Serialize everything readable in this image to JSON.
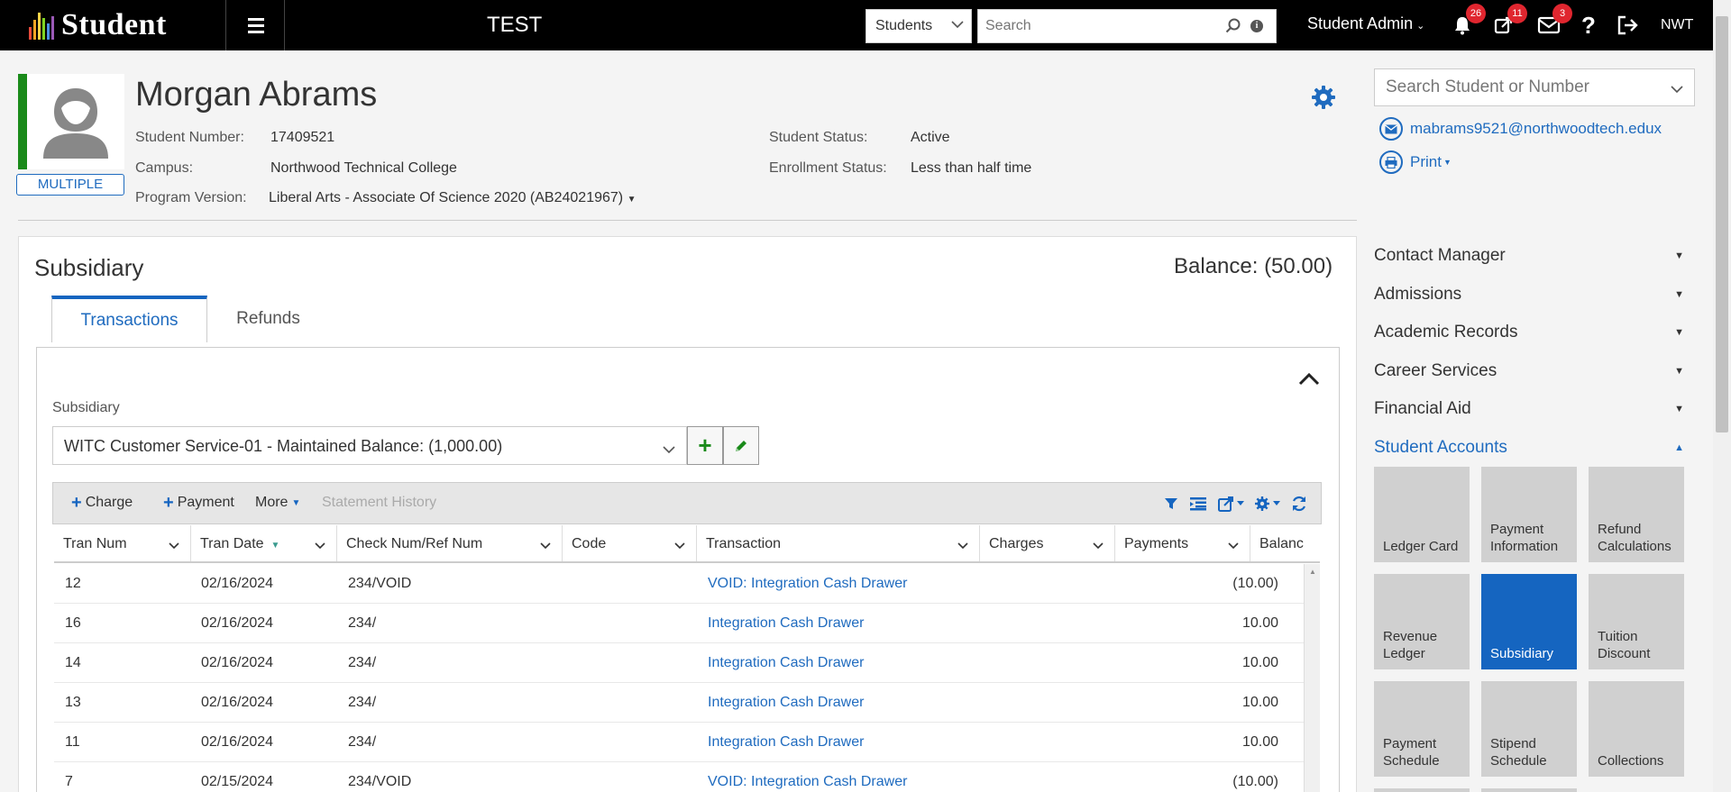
{
  "topbar": {
    "logo_text": "Student",
    "env_title": "TEST",
    "search_scope": "Students",
    "search_placeholder": "Search",
    "user_name": "Student Admin",
    "notifications_count": "26",
    "tasks_count": "11",
    "messages_count": "3",
    "help_label": "?",
    "org_code": "NWT"
  },
  "student": {
    "name": "Morgan Abrams",
    "badge": "MULTIPLE",
    "number_label": "Student Number:",
    "number": "17409521",
    "campus_label": "Campus:",
    "campus": "Northwood Technical College",
    "program_label": "Program Version:",
    "program": "Liberal Arts - Associate Of Science 2020 (AB24021967)",
    "status_label": "Student Status:",
    "status": "Active",
    "enrollment_label": "Enrollment Status:",
    "enrollment": "Less than half time"
  },
  "right_panel": {
    "search_placeholder": "Search Student or Number",
    "email": "mabrams9521@northwoodtech.edux",
    "print_label": "Print",
    "menu": [
      {
        "label": "Contact Manager"
      },
      {
        "label": "Admissions"
      },
      {
        "label": "Academic Records"
      },
      {
        "label": "Career Services"
      },
      {
        "label": "Financial Aid"
      },
      {
        "label": "Student Accounts"
      }
    ],
    "tiles": [
      {
        "label": "Ledger Card"
      },
      {
        "label": "Payment Information"
      },
      {
        "label": "Refund Calculations"
      },
      {
        "label": "Revenue Ledger"
      },
      {
        "label": "Subsidiary"
      },
      {
        "label": "Tuition Discount"
      },
      {
        "label": "Payment Schedule"
      },
      {
        "label": "Stipend Schedule"
      },
      {
        "label": "Collections"
      }
    ]
  },
  "main": {
    "title": "Subsidiary",
    "balance": "Balance: (50.00)",
    "tabs": [
      {
        "label": "Transactions"
      },
      {
        "label": "Refunds"
      }
    ],
    "subsidiary_label": "Subsidiary",
    "subsidiary_value": "WITC Customer Service-01 - Maintained Balance: (1,000.00)",
    "toolbar": {
      "charge": "Charge",
      "payment": "Payment",
      "more": "More",
      "statement_history": "Statement History"
    },
    "columns": [
      "Tran Num",
      "Tran Date",
      "Check Num/Ref Num",
      "Code",
      "Transaction",
      "Charges",
      "Payments",
      "Balanc"
    ],
    "rows": [
      {
        "tran_num": "12",
        "tran_date": "02/16/2024",
        "check_ref": "234/VOID",
        "code": "",
        "transaction": "VOID: Integration Cash Drawer",
        "charges": "",
        "payments": "(10.00)"
      },
      {
        "tran_num": "16",
        "tran_date": "02/16/2024",
        "check_ref": "234/",
        "code": "",
        "transaction": "Integration Cash Drawer",
        "charges": "",
        "payments": "10.00"
      },
      {
        "tran_num": "14",
        "tran_date": "02/16/2024",
        "check_ref": "234/",
        "code": "",
        "transaction": "Integration Cash Drawer",
        "charges": "",
        "payments": "10.00"
      },
      {
        "tran_num": "13",
        "tran_date": "02/16/2024",
        "check_ref": "234/",
        "code": "",
        "transaction": "Integration Cash Drawer",
        "charges": "",
        "payments": "10.00"
      },
      {
        "tran_num": "11",
        "tran_date": "02/16/2024",
        "check_ref": "234/",
        "code": "",
        "transaction": "Integration Cash Drawer",
        "charges": "",
        "payments": "10.00"
      },
      {
        "tran_num": "7",
        "tran_date": "02/15/2024",
        "check_ref": "234/VOID",
        "code": "",
        "transaction": "VOID: Integration Cash Drawer",
        "charges": "",
        "payments": "(10.00)"
      }
    ]
  },
  "colors": {
    "accent": "#1565c0",
    "link": "#1f6bbf",
    "status_green": "#1a8a1a",
    "badge_red": "#e0262f"
  }
}
